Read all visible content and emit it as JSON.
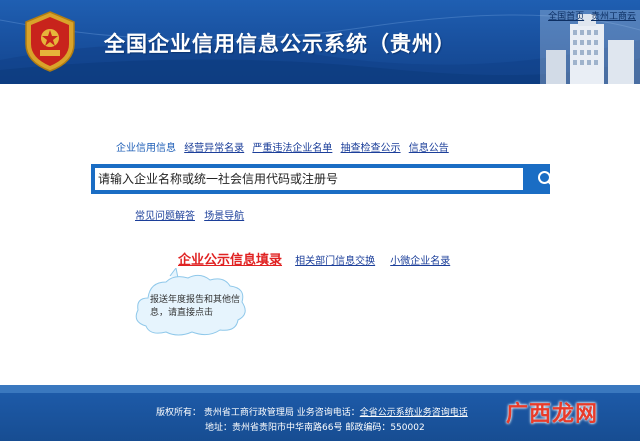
{
  "header": {
    "title": "全国企业信用信息公示系统（贵州）",
    "top_links": [
      "全国首页",
      "贵州工商云"
    ]
  },
  "nav": {
    "items": [
      "企业信用信息",
      "经营异常名录",
      "严重违法企业名单",
      "抽查检查公示",
      "信息公告"
    ]
  },
  "search": {
    "placeholder": "请输入企业名称或统一社会信用代码或注册号",
    "button_label": "搜索"
  },
  "help_links": [
    "常见问题解答",
    "场景导航"
  ],
  "fill_links": {
    "main": "企业公示信息填录",
    "others": [
      "相关部门信息交换",
      "小微企业名录"
    ]
  },
  "tooltip": {
    "text": "报送年度报告和其他信息，请直接点击"
  },
  "footer": {
    "line1_prefix": "版权所有： 贵州省工商行政管理局  业务咨询电话：",
    "line1_link": "全省公示系统业务咨询电话",
    "line2": "地址：贵州省贵阳市中华南路66号  邮政编码：550002"
  },
  "watermark": "广西龙网",
  "colors": {
    "header_blue": "#184f9d",
    "search_blue": "#1a6dc4",
    "fill_red": "#e02222",
    "link_blue": "#1c3f9a"
  }
}
